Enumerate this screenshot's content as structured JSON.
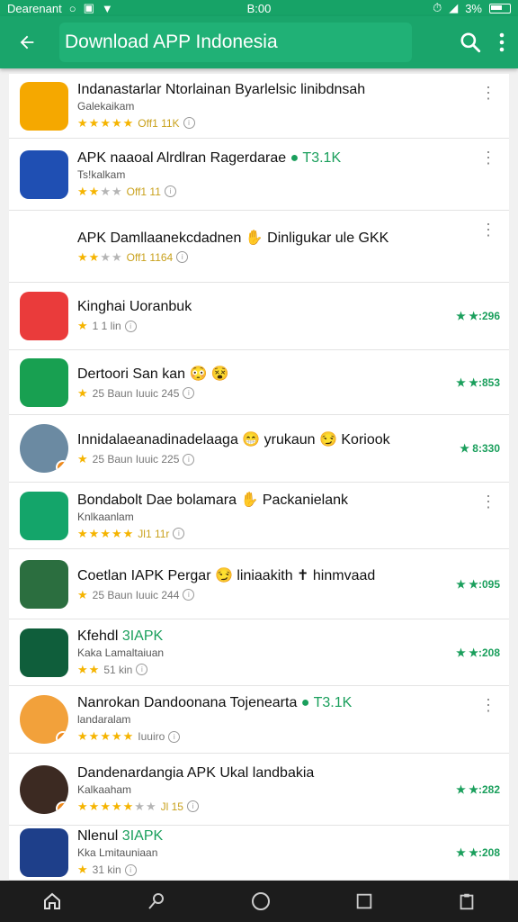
{
  "status": {
    "carrier": "Dearenant",
    "time": "B:00",
    "battery": "3%"
  },
  "app_bar": {
    "title": "Download APP Indonesia"
  },
  "items": [
    {
      "title": "Indanastarlar Ntorlainan Byarlelsic",
      "title_end": " linibdnsah",
      "sub": "Galekaikam",
      "stars_full": 5,
      "stars_off": 0,
      "rating_text": "Off1 11K",
      "right": "menu",
      "icon": "orange-home-icon",
      "icon_bg": "#f5a800"
    },
    {
      "title": "APK naaoal Alrdlran Ragerdarae",
      "title_green": "● T3.1K",
      "sub": "Ts!kalkam",
      "stars_full": 2,
      "stars_off": 2,
      "rating_text": "Off1 11",
      "right": "menu",
      "icon": "play-store-icon",
      "icon_bg": "#1f4fb3"
    },
    {
      "title": "APK Damllaanekcdadnen ✋ Dinligukar ule GKK",
      "sub": "",
      "stars_full": 2,
      "stars_off": 2,
      "rating_text": "Off1 1164",
      "right": "menu",
      "icon": "woman-avatar-icon",
      "icon_bg": "#ffffff"
    },
    {
      "title": "Kinghai Uoranbuk",
      "sub": "",
      "stars_full": 1,
      "stars_off": 0,
      "rating_text": "1 1 lin",
      "right": "★ ★:296",
      "icon": "red-cam-icon",
      "icon_bg": "#ea3b3b"
    },
    {
      "title": "Dertoori San kan 😳 😵",
      "sub": "",
      "stars_full": 1,
      "stars_off": 0,
      "rating_text": "25 Baun  Iuuic 245",
      "right": "★ ★:853",
      "icon": "green-app-icon",
      "icon_bg": "#18a051"
    },
    {
      "title": "Innidalaeanadinadelaaga 😁 yrukaun 😏 Koriook",
      "sub": "",
      "stars_full": 1,
      "stars_off": 0,
      "rating_text": "25 Baun  Iuuic 225",
      "right": "★ 8:330",
      "icon": "man-avatar-icon",
      "icon_bg": "#6b8aa2"
    },
    {
      "title": "Bondabolt Dae bolamara ✋ Packanielank",
      "sub": "Knlkaanlam",
      "stars_full": 5,
      "stars_off": 0,
      "rating_text": "Jl1 11r",
      "right": "menu",
      "icon": "green-d-icon",
      "icon_bg": "#14a56a"
    },
    {
      "title": "Coetlan IAPK Pergar 😏 liniaakith ✝ hinmvaad",
      "sub": "",
      "stars_full": 1,
      "stars_off": 0,
      "rating_text": "25 Baun  Iuuic 244",
      "right": "★ ★:095",
      "icon": "temple-icon",
      "icon_bg": "#2b6e3f"
    },
    {
      "title": "Kfehdl",
      "title_green": "3IAPK",
      "sub": "Kaka Lamaltaiuan",
      "stars_full": 2,
      "stars_off": 0,
      "rating_text": "51 kin",
      "right": "★ ★:208",
      "icon": "dark-green-cam-icon",
      "icon_bg": "#0f5e3b"
    },
    {
      "title": "Nanrokan Dandoonana Tojenearta",
      "title_green": "● T3.1K",
      "sub": "landaralam",
      "stars_full": 5,
      "stars_off": 0,
      "rating_text": "Iuuiro",
      "right": "menu",
      "icon": "couple-avatar-icon",
      "icon_bg": "#f2a13b"
    },
    {
      "title": "Dandenardangia APK Ukal landbakia",
      "sub": "Kalkaaham",
      "stars_full": 5,
      "stars_off": 2,
      "rating_text": "Jl 15",
      "right": "★ ★:282",
      "icon": "portrait-icon",
      "icon_bg": "#3c2a22"
    },
    {
      "title": "Nlenul",
      "title_green": "3IAPK",
      "sub": "Kka Lmitauniaan",
      "stars_full": 1,
      "stars_off": 0,
      "rating_text": "31 kin",
      "right": "★ ★:208",
      "icon": "blue-house-icon",
      "icon_bg": "#1e3f8a"
    }
  ]
}
